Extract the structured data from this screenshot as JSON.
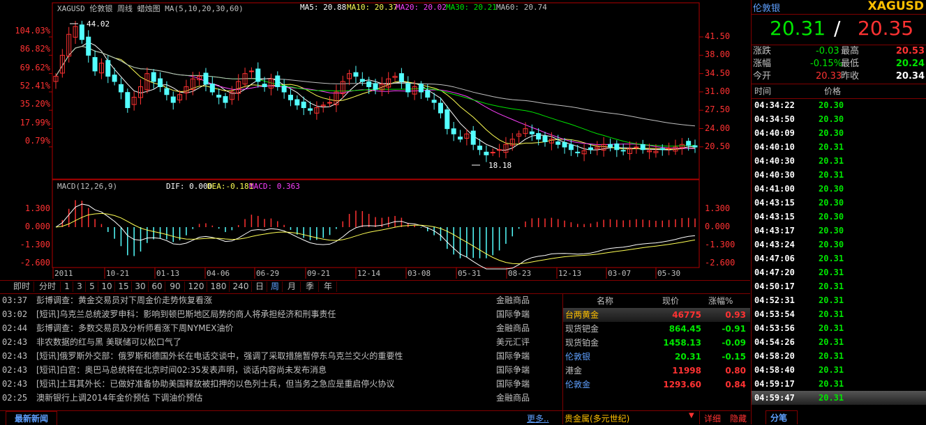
{
  "chart": {
    "header": "XAGUSD 伦敦银 周线  蜡烛图 MA(5,10,20,30,60)",
    "ma5": "MA5: 20.88",
    "ma10": "MA10: 20.37",
    "ma20": "MA20: 20.02",
    "ma30": "MA30: 20.21",
    "ma60": "MA60: 20.74",
    "high_marker": "44.02",
    "low_marker": "18.18",
    "left_axis": [
      "104.03%",
      "86.82%",
      "69.62%",
      "52.41%",
      "35.20%",
      "17.99%",
      "0.79%"
    ],
    "right_axis": [
      "41.50",
      "38.00",
      "34.50",
      "31.00",
      "27.50",
      "24.00",
      "20.50"
    ],
    "macd_header": "MACD(12,26,9)",
    "dif": "DIF: 0.000",
    "dea": "DEA:-0.181",
    "macd": "MACD: 0.363",
    "macd_left_axis": [
      "1.300",
      "0.000",
      "-1.300",
      "-2.600"
    ],
    "macd_right_axis": [
      "1.300",
      "0.000",
      "-1.300",
      "-2.600"
    ],
    "x_labels": [
      "2011",
      "10-21",
      "01-13",
      "04-06",
      "06-29",
      "09-21",
      "12-14",
      "03-08",
      "05-31",
      "08-23",
      "12-13",
      "03-07",
      "05-30"
    ],
    "colors": {
      "up": "#ff3232",
      "down": "#54ffff",
      "ma5": "#ffffff",
      "ma10": "#ffff54",
      "ma20": "#ff40ff",
      "ma30": "#00e600",
      "ma60": "#c0c0c0"
    }
  },
  "chart_data": {
    "type": "candlestick",
    "title": "XAGUSD 伦敦银 周线",
    "ylabel": "",
    "ylim": [
      18.0,
      44.5
    ],
    "weekly_close_approx": [
      34.0,
      38.0,
      42.0,
      43.5,
      41.0,
      38.0,
      35.0,
      36.5,
      34.0,
      33.0,
      31.0,
      28.0,
      30.0,
      32.0,
      34.5,
      33.0,
      32.0,
      30.5,
      29.0,
      30.5,
      32.0,
      33.5,
      34.0,
      32.5,
      31.0,
      30.0,
      29.0,
      31.0,
      33.0,
      34.5,
      35.0,
      33.0,
      32.0,
      33.5,
      32.0,
      31.0,
      29.5,
      28.5,
      28.0,
      27.5,
      28.0,
      28.5,
      29.0,
      31.0,
      33.0,
      34.5,
      34.0,
      33.0,
      32.0,
      31.5,
      32.5,
      33.5,
      34.0,
      33.0,
      31.0,
      32.0,
      31.0,
      30.0,
      29.0,
      27.0,
      24.0,
      23.0,
      22.0,
      23.0,
      21.0,
      20.0,
      19.0,
      19.5,
      20.0,
      21.0,
      22.0,
      23.0,
      24.0,
      23.0,
      22.0,
      21.5,
      22.0,
      21.0,
      20.5,
      20.0,
      19.5,
      19.8,
      20.0,
      20.5,
      21.0,
      20.5,
      20.0,
      19.8,
      20.2,
      20.5,
      20.0,
      19.8,
      19.7,
      20.0,
      20.3,
      20.5,
      21.0,
      20.8,
      20.5
    ],
    "series": [
      {
        "name": "MA5",
        "last": 20.88
      },
      {
        "name": "MA10",
        "last": 20.37
      },
      {
        "name": "MA20",
        "last": 20.02
      },
      {
        "name": "MA30",
        "last": 20.21
      },
      {
        "name": "MA60",
        "last": 20.74
      }
    ],
    "high": 44.02,
    "low": 18.18,
    "macd": {
      "dif": 0.0,
      "dea": -0.181,
      "macd": 0.363,
      "ylim": [
        -2.6,
        1.3
      ]
    }
  },
  "periods": [
    "即时",
    "分时",
    "1",
    "3",
    "5",
    "10",
    "15",
    "30",
    "60",
    "90",
    "120",
    "180",
    "240",
    "日",
    "周",
    "月",
    "季",
    "年"
  ],
  "active_period": "周",
  "news": [
    {
      "time": "03:37",
      "title": "彭博调查：黄金交易员对下周金价走势恢复看涨",
      "cat": "金融商品"
    },
    {
      "time": "03:02",
      "title": "[短讯]乌克兰总统波罗申科：影响到顿巴斯地区局势的商人将承担经济和刑事责任",
      "cat": "国际争端"
    },
    {
      "time": "02:44",
      "title": "彭博调查：多数交易员及分析师看涨下周NYMEX油价",
      "cat": "金融商品"
    },
    {
      "time": "02:43",
      "title": "非农数据的红与黑 美联储可以松口气了",
      "cat": "美元汇评"
    },
    {
      "time": "02:43",
      "title": "[短讯]俄罗斯外交部：俄罗斯和德国外长在电话交谈中，强调了采取措施暂停东乌克兰交火的重要性",
      "cat": "国际争端"
    },
    {
      "time": "02:43",
      "title": "[短讯]白宫：奥巴马总统将在北京时间02:35发表声明，谈话内容尚未发布消息",
      "cat": "国际争端"
    },
    {
      "time": "02:43",
      "title": "[短讯]土耳其外长：已做好准备协助美国释放被扣押的以色列士兵，但当务之急应是重启停火协议",
      "cat": "国际争端"
    },
    {
      "time": "02:25",
      "title": "澳新银行上调2014年金价预估 下调油价预估",
      "cat": "金融商品"
    }
  ],
  "news_tab": "最新新闻",
  "news_more": "更多..",
  "watchlist": {
    "headers": {
      "name": "名称",
      "price": "现价",
      "chg": "涨幅%"
    },
    "rows": [
      {
        "name": "台两黄金",
        "price": "46775",
        "chg": "0.93",
        "name_color": "#ffc000",
        "color": "#ff3232",
        "selected": true
      },
      {
        "name": "现货钯金",
        "price": "864.45",
        "chg": "-0.91",
        "name_color": "#c0c0c0",
        "color": "#00e600"
      },
      {
        "name": "现货铂金",
        "price": "1458.13",
        "chg": "-0.09",
        "name_color": "#c0c0c0",
        "color": "#00e600"
      },
      {
        "name": "伦敦银",
        "price": "20.31",
        "chg": "-0.15",
        "name_color": "#5fa0ff",
        "color": "#00e600"
      },
      {
        "name": "港金",
        "price": "11998",
        "chg": "0.80",
        "name_color": "#c0c0c0",
        "color": "#ff3232"
      },
      {
        "name": "伦敦金",
        "price": "1293.60",
        "chg": "0.84",
        "name_color": "#5fa0ff",
        "color": "#ff3232"
      }
    ],
    "group": "贵金属(多元世纪)",
    "detail": "详细",
    "hide": "隐藏"
  },
  "quote": {
    "name": "伦敦银",
    "code": "XAGUSD",
    "bid": "20.31",
    "slash": "/",
    "ask": "20.35",
    "change_label": "涨跌",
    "change": "-0.03",
    "high_label": "最高",
    "high": "20.53",
    "pct_label": "涨幅",
    "pct": "-0.15%",
    "low_label": "最低",
    "low": "20.24",
    "open_label": "今开",
    "open": "20.33",
    "prev_label": "昨收",
    "prev": "20.34",
    "ticks_header_time": "时间",
    "ticks_header_price": "价格",
    "ticks": [
      {
        "time": "04:34:22",
        "price": "20.30"
      },
      {
        "time": "04:34:50",
        "price": "20.30"
      },
      {
        "time": "04:40:09",
        "price": "20.30"
      },
      {
        "time": "04:40:10",
        "price": "20.31"
      },
      {
        "time": "04:40:30",
        "price": "20.31"
      },
      {
        "time": "04:40:30",
        "price": "20.31"
      },
      {
        "time": "04:41:00",
        "price": "20.30"
      },
      {
        "time": "04:43:15",
        "price": "20.30"
      },
      {
        "time": "04:43:15",
        "price": "20.30"
      },
      {
        "time": "04:43:17",
        "price": "20.30"
      },
      {
        "time": "04:43:24",
        "price": "20.30"
      },
      {
        "time": "04:47:06",
        "price": "20.31"
      },
      {
        "time": "04:47:20",
        "price": "20.31"
      },
      {
        "time": "04:50:17",
        "price": "20.31"
      },
      {
        "time": "04:52:31",
        "price": "20.31"
      },
      {
        "time": "04:53:54",
        "price": "20.31"
      },
      {
        "time": "04:53:56",
        "price": "20.31"
      },
      {
        "time": "04:54:26",
        "price": "20.31"
      },
      {
        "time": "04:58:20",
        "price": "20.31"
      },
      {
        "time": "04:58:40",
        "price": "20.31"
      },
      {
        "time": "04:59:17",
        "price": "20.31"
      },
      {
        "time": "04:59:47",
        "price": "20.31"
      }
    ],
    "tab": "分笔"
  }
}
